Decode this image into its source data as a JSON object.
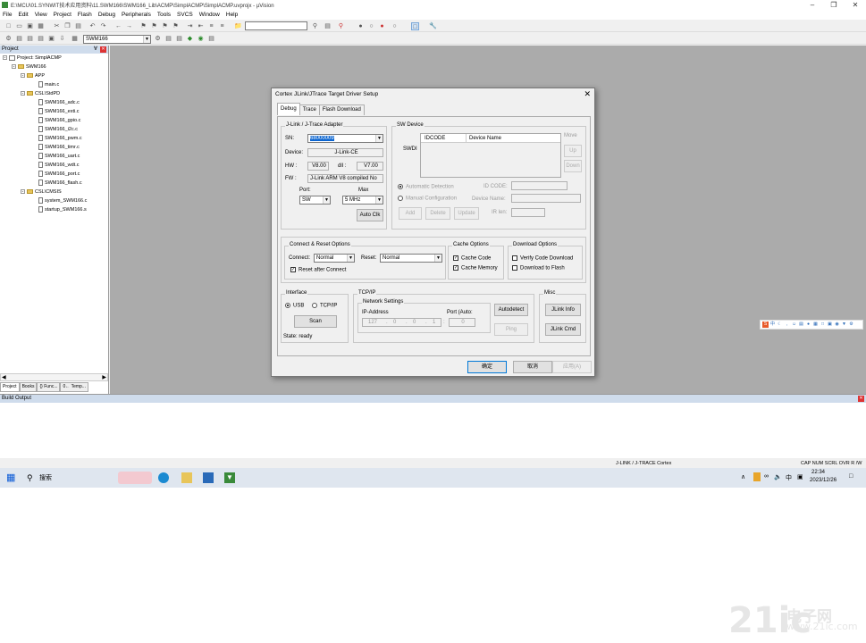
{
  "window": {
    "title": "E:\\MCU\\01.SYNWIT技术应用资料\\11.SWM166\\SWM166_Lib\\ACMP\\SimplACMP\\SimplACMP.uvprojx - µVision"
  },
  "menu": [
    "File",
    "Edit",
    "View",
    "Project",
    "Flash",
    "Debug",
    "Peripherals",
    "Tools",
    "SVCS",
    "Window",
    "Help"
  ],
  "toolbar": {
    "target": "SWM166"
  },
  "project": {
    "title": "Project",
    "root": "Project: SimplACMP",
    "target": "SWM166",
    "groups": [
      {
        "name": "APP",
        "files": [
          "main.c"
        ]
      },
      {
        "name": "CSL\\StdPD",
        "files": [
          "SWM166_adc.c",
          "SWM166_exti.c",
          "SWM166_gpio.c",
          "SWM166_i2c.c",
          "SWM166_pwm.c",
          "SWM166_timr.c",
          "SWM166_uart.c",
          "SWM166_wdt.c",
          "SWM166_port.c",
          "SWM166_flash.c"
        ]
      },
      {
        "name": "CSL\\CMSIS",
        "files": [
          "system_SWM166.c",
          "startup_SWM166.s"
        ]
      }
    ],
    "tabs": [
      "Project",
      "Books",
      "{} Func...",
      "0← Temp..."
    ]
  },
  "build_output": {
    "title": "Build Output"
  },
  "statusbar": {
    "driver": "J-LINK / J-TRACE Cortex",
    "indicators": "CAP  NUM  SCRL  OVR  R /W"
  },
  "taskbar": {
    "search": "搜索",
    "time": "22:34",
    "date": "2023/12/26",
    "ime": "中"
  },
  "dialog": {
    "title": "Cortex JLink/JTrace Target Driver Setup",
    "tabs": [
      "Debug",
      "Trace",
      "Flash Download"
    ],
    "jlink": {
      "group": "J-Link / J-Trace Adapter",
      "sn_label": "SN:",
      "sn": "68000009",
      "device_label": "Device:",
      "device": "J-Link-CE",
      "hw_label": "HW :",
      "hw": "V8.00",
      "dll_label": "dll :",
      "dll": "V7.00",
      "fw_label": "FW :",
      "fw": "J-Link ARM V8 compiled No",
      "port_label": "Port:",
      "port": "SW",
      "max_label": "Max",
      "max": "5 MHz",
      "auto_clk": "Auto Clk"
    },
    "sw": {
      "group": "SW Device",
      "swdi": "SWDI",
      "col1": "IDCODE",
      "col2": "Device Name",
      "move": "Move",
      "up": "Up",
      "down": "Down",
      "auto_detect": "Automatic Detection",
      "manual": "Manual Configuration",
      "idcode": "ID CODE:",
      "devname": "Device Name:",
      "irlen": "IR len:",
      "add": "Add",
      "delete": "Delete",
      "update": "Update"
    },
    "connect": {
      "group": "Connect & Reset Options",
      "connect_label": "Connect:",
      "connect": "Normal",
      "reset_label": "Reset:",
      "reset": "Normal",
      "reset_after": "Reset after Connect"
    },
    "cache": {
      "group": "Cache Options",
      "code": "Cache Code",
      "memory": "Cache Memory"
    },
    "download": {
      "group": "Download Options",
      "verify": "Verify Code Download",
      "to_flash": "Download to Flash"
    },
    "interface": {
      "group": "Interface",
      "usb": "USB",
      "tcpip": "TCP/IP",
      "scan": "Scan",
      "state": "State: ready"
    },
    "tcp": {
      "group": "TCP/IP",
      "net": "Network Settings",
      "ip_label": "IP-Address",
      "port_label": "Port (Auto:",
      "ip": [
        "127",
        "0",
        "0",
        "1"
      ],
      "port": "0",
      "autodetect": "Autodetect",
      "ping": "Ping"
    },
    "misc": {
      "group": "Misc",
      "info": "JLink Info",
      "cmd": "JLink Cmd"
    },
    "ok": "确定",
    "cancel": "取消",
    "apply": "应用(A)"
  },
  "watermark": {
    "brand": "21ic",
    "cn": "电子网",
    "url": "www.21ic.com"
  }
}
